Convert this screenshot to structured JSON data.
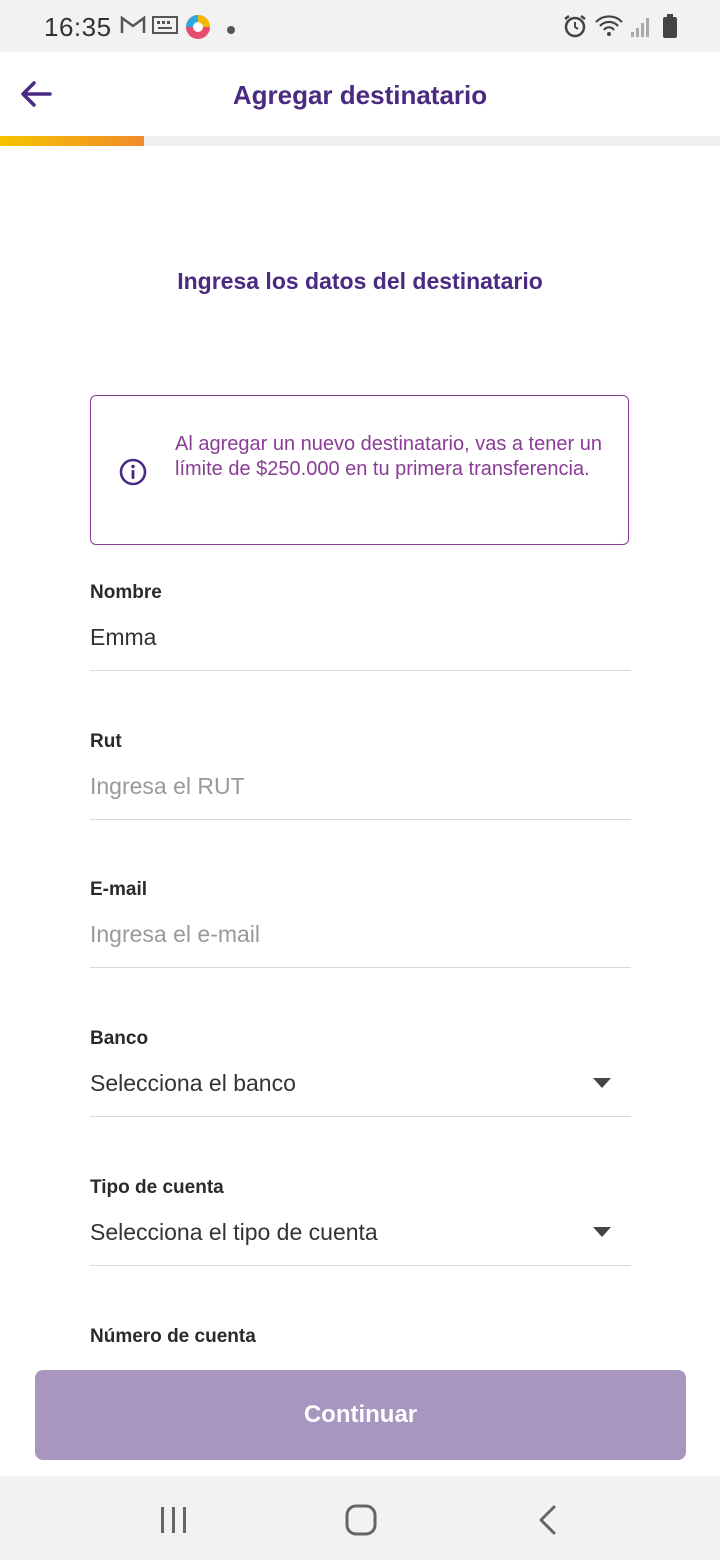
{
  "status_bar": {
    "time": "16:35",
    "icons_left": [
      "gmail-icon",
      "keyboard-icon",
      "app-icon",
      "dot-icon"
    ],
    "icons_right": [
      "alarm-icon",
      "wifi-icon",
      "signal-icon",
      "battery-icon"
    ]
  },
  "app_bar": {
    "title": "Agregar destinatario",
    "back_icon": "arrow-left-icon",
    "progress_percent": 20
  },
  "form": {
    "section_title": "Ingresa los datos del destinatario",
    "info_text": "Al agregar un nuevo destinatario, vas a tener un límite de $250.000 en tu primera transferencia.",
    "nombre_label": "Nombre",
    "nombre_value": "Emma",
    "rut_label": "Rut",
    "rut_placeholder": "Ingresa el RUT",
    "email_label": "E-mail",
    "email_placeholder": "Ingresa el e-mail",
    "banco_label": "Banco",
    "banco_value": "Selecciona el banco",
    "tipo_label": "Tipo de cuenta",
    "tipo_value": "Selecciona el tipo de cuenta",
    "numero_label": "Número de cuenta"
  },
  "continue_label": "Continuar",
  "colors": {
    "brand": "#4b2a82",
    "info": "#8a3c96",
    "button_disabled": "#a797c0",
    "progress_start": "#f5c400",
    "progress_end": "#f08b2a"
  },
  "nav_bar": {
    "icons": [
      "recents-icon",
      "home-icon",
      "back-icon"
    ]
  }
}
